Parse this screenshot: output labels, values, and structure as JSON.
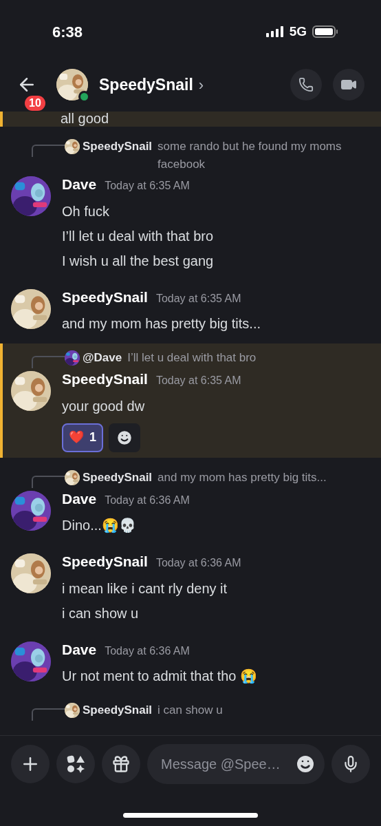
{
  "status_bar": {
    "time": "6:38",
    "network": "5G"
  },
  "header": {
    "unread_badge": "10",
    "name": "SpeedySnail",
    "chevron": "›",
    "online": true,
    "avatar": {
      "kind": "picture",
      "color": "#d9c9a8"
    }
  },
  "messages": [
    {
      "kind": "tail",
      "highlighted": true,
      "lines": [
        "all good"
      ]
    },
    {
      "kind": "message",
      "highlighted": false,
      "reply": {
        "name": "SpeedySnail",
        "text": "some rando but he found my moms facebook",
        "avatar": {
          "kind": "picture",
          "color": "#d9c9a8"
        }
      },
      "author": "Dave",
      "time": "Today at 6:35 AM",
      "avatar": {
        "kind": "picture",
        "color": "#6b3fb0"
      },
      "lines": [
        "Oh fuck",
        "I’ll let u deal with that bro",
        "I wish u all the best gang"
      ]
    },
    {
      "kind": "message",
      "highlighted": false,
      "author": "SpeedySnail",
      "time": "Today at 6:35 AM",
      "avatar": {
        "kind": "picture",
        "color": "#d9c9a8"
      },
      "lines": [
        "and my mom has pretty big tits..."
      ]
    },
    {
      "kind": "message",
      "highlighted": true,
      "reply": {
        "name": "@Dave",
        "text": "I’ll let u deal with that bro",
        "avatar": {
          "kind": "picture",
          "color": "#6b3fb0"
        }
      },
      "author": "SpeedySnail",
      "time": "Today at 6:35 AM",
      "avatar": {
        "kind": "picture",
        "color": "#d9c9a8"
      },
      "lines": [
        "your good dw"
      ],
      "reactions": [
        {
          "emoji": "❤️",
          "count": "1",
          "selected": true
        }
      ]
    },
    {
      "kind": "message",
      "highlighted": false,
      "reply": {
        "name": "SpeedySnail",
        "text": "and my mom has pretty big tits...",
        "avatar": {
          "kind": "picture",
          "color": "#d9c9a8"
        }
      },
      "author": "Dave",
      "time": "Today at 6:36 AM",
      "avatar": {
        "kind": "picture",
        "color": "#6b3fb0"
      },
      "lines": [
        "Dino...😭💀"
      ]
    },
    {
      "kind": "message",
      "highlighted": false,
      "author": "SpeedySnail",
      "time": "Today at 6:36 AM",
      "avatar": {
        "kind": "picture",
        "color": "#d9c9a8"
      },
      "lines": [
        "i mean like i cant rly deny it",
        "i can show u"
      ]
    },
    {
      "kind": "message",
      "highlighted": false,
      "author": "Dave",
      "time": "Today at 6:36 AM",
      "avatar": {
        "kind": "picture",
        "color": "#6b3fb0"
      },
      "lines": [
        "Ur not ment to admit that tho 😭"
      ]
    },
    {
      "kind": "cut",
      "highlighted": false,
      "reply": {
        "name": "SpeedySnail",
        "text": "i can show u",
        "avatar": {
          "kind": "picture",
          "color": "#d9c9a8"
        }
      }
    }
  ],
  "composer": {
    "placeholder": "Message @Spee…"
  }
}
